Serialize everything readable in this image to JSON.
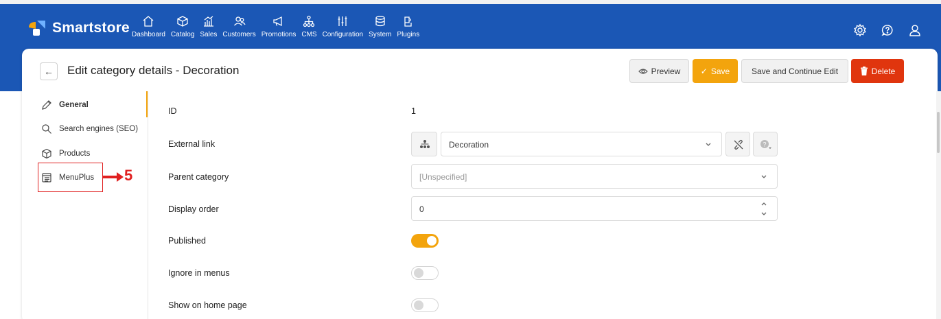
{
  "app": {
    "name": "Smartstore",
    "brand_color": "#1b57b5",
    "accent_color": "#f3a40d",
    "danger_color": "#e0350e"
  },
  "nav": [
    {
      "label": "Dashboard",
      "icon": "home-icon"
    },
    {
      "label": "Catalog",
      "icon": "box-icon"
    },
    {
      "label": "Sales",
      "icon": "sales-chart-icon"
    },
    {
      "label": "Customers",
      "icon": "users-icon"
    },
    {
      "label": "Promotions",
      "icon": "megaphone-icon"
    },
    {
      "label": "CMS",
      "icon": "sitemap-icon"
    },
    {
      "label": "Configuration",
      "icon": "sliders-icon"
    },
    {
      "label": "System",
      "icon": "database-icon"
    },
    {
      "label": "Plugins",
      "icon": "plugin-icon"
    }
  ],
  "top_right_icons": [
    "settings-icon",
    "help-icon",
    "user-icon"
  ],
  "header": {
    "title": "Edit category details - Decoration",
    "preview_label": "Preview",
    "save_label": "Save",
    "save_continue_label": "Save and Continue Edit",
    "delete_label": "Delete"
  },
  "sidebar": {
    "items": [
      {
        "label": "General",
        "icon": "pencil-icon",
        "active": true
      },
      {
        "label": "Search engines (SEO)",
        "icon": "search-icon",
        "active": false
      },
      {
        "label": "Products",
        "icon": "cube-icon",
        "active": false
      },
      {
        "label": "MenuPlus",
        "icon": "menu-icon",
        "active": false
      }
    ]
  },
  "annotation": {
    "number": "5"
  },
  "form": {
    "id_label": "ID",
    "id_value": "1",
    "external_link_label": "External link",
    "external_link_value": "Decoration",
    "parent_category_label": "Parent category",
    "parent_category_value": "[Unspecified]",
    "display_order_label": "Display order",
    "display_order_value": "0",
    "published_label": "Published",
    "published_on": true,
    "ignore_menus_label": "Ignore in menus",
    "ignore_menus_on": false,
    "show_home_label": "Show on home page",
    "show_home_on": false
  }
}
